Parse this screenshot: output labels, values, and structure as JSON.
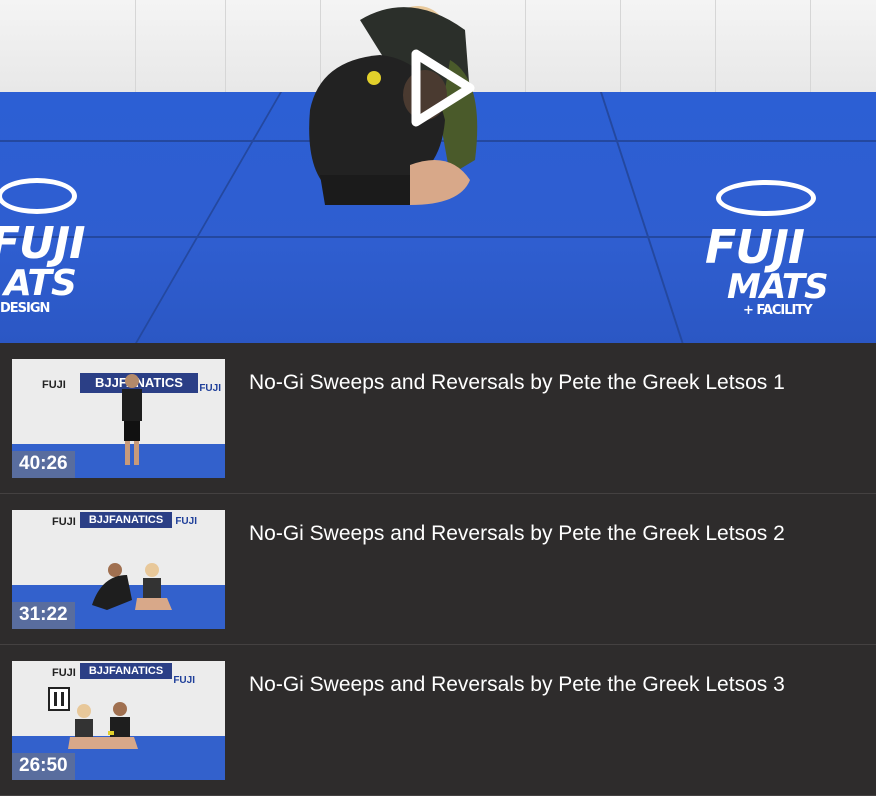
{
  "player": {
    "state_icon": "play-icon",
    "mat_brand_left": [
      "FUJI",
      "ATS"
    ],
    "mat_brand_left_sub": "DESIGN",
    "mat_brand_right": [
      "FUJI",
      "MATS"
    ],
    "mat_brand_right_sub": "+ FACILITY"
  },
  "playlist": [
    {
      "title": "No-Gi Sweeps and Reversals by Pete the Greek Letsos 1",
      "duration": "40:26",
      "banner": "BJJFANATICS",
      "fuji": "FUJI"
    },
    {
      "title": "No-Gi Sweeps and Reversals by Pete the Greek Letsos 2",
      "duration": "31:22",
      "banner": "BJJFANATICS",
      "fuji": "FUJI"
    },
    {
      "title": "No-Gi Sweeps and Reversals by Pete the Greek Letsos 3",
      "duration": "26:50",
      "banner": "BJJFANATICS",
      "fuji": "FUJI"
    }
  ],
  "colors": {
    "background": "#2e2c2c",
    "mat_blue": "#2f5ed0",
    "wall": "#f0f0f0",
    "text": "#ffffff"
  }
}
